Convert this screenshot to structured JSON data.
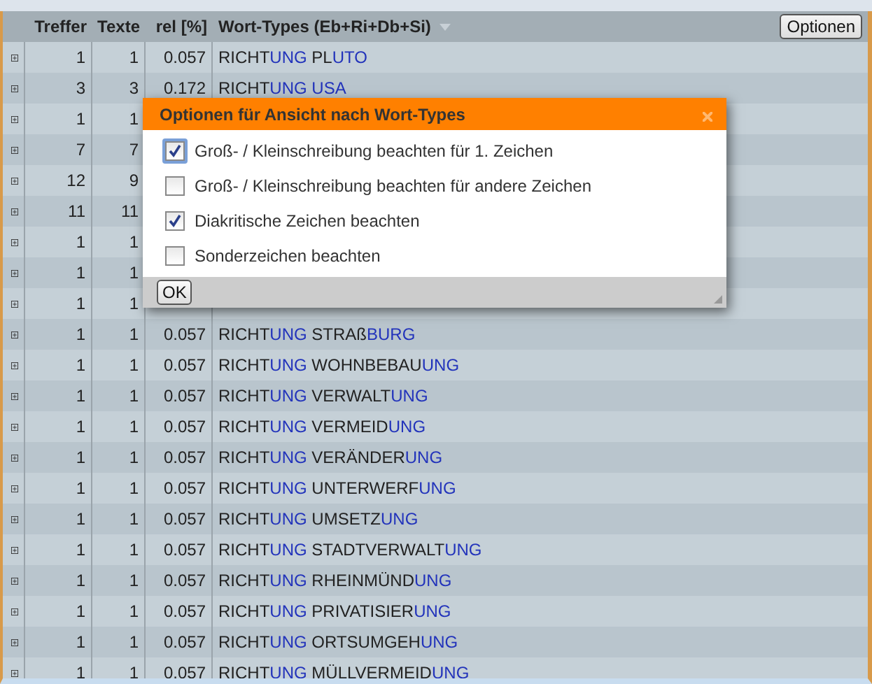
{
  "table": {
    "columns": [
      "Treffer",
      "Texte",
      "rel [%]",
      "Wort-Types (Eb+Ri+Db+Si)"
    ],
    "options_button": "Optionen",
    "rows": [
      {
        "treffer": "1",
        "texte": "1",
        "rel": "0.057",
        "parts": [
          "RICHT",
          "UNG",
          " PL",
          "UTO"
        ]
      },
      {
        "treffer": "3",
        "texte": "3",
        "rel": "0.172",
        "parts": [
          "RICHT",
          "UNG USA"
        ]
      },
      {
        "treffer": "1",
        "texte": "1"
      },
      {
        "treffer": "7",
        "texte": "7"
      },
      {
        "treffer": "12",
        "texte": "9"
      },
      {
        "treffer": "11",
        "texte": "11"
      },
      {
        "treffer": "1",
        "texte": "1"
      },
      {
        "treffer": "1",
        "texte": "1"
      },
      {
        "treffer": "1",
        "texte": "1"
      },
      {
        "treffer": "1",
        "texte": "1",
        "rel": "0.057",
        "parts": [
          "RICHT",
          "UNG",
          " STRAß",
          "BURG"
        ]
      },
      {
        "treffer": "1",
        "texte": "1",
        "rel": "0.057",
        "parts": [
          "RICHT",
          "UNG",
          " WOHNBEBAU",
          "UNG"
        ]
      },
      {
        "treffer": "1",
        "texte": "1",
        "rel": "0.057",
        "parts": [
          "RICHT",
          "UNG",
          " VERWALT",
          "UNG"
        ]
      },
      {
        "treffer": "1",
        "texte": "1",
        "rel": "0.057",
        "parts": [
          "RICHT",
          "UNG",
          " VERMEID",
          "UNG"
        ]
      },
      {
        "treffer": "1",
        "texte": "1",
        "rel": "0.057",
        "parts": [
          "RICHT",
          "UNG",
          " VERÄNDER",
          "UNG"
        ]
      },
      {
        "treffer": "1",
        "texte": "1",
        "rel": "0.057",
        "parts": [
          "RICHT",
          "UNG",
          " UNTERWERF",
          "UNG"
        ]
      },
      {
        "treffer": "1",
        "texte": "1",
        "rel": "0.057",
        "parts": [
          "RICHT",
          "UNG",
          " UMSETZ",
          "UNG"
        ]
      },
      {
        "treffer": "1",
        "texte": "1",
        "rel": "0.057",
        "parts": [
          "RICHT",
          "UNG",
          " STADTVERWALT",
          "UNG"
        ]
      },
      {
        "treffer": "1",
        "texte": "1",
        "rel": "0.057",
        "parts": [
          "RICHT",
          "UNG",
          " RHEINMÜND",
          "UNG"
        ]
      },
      {
        "treffer": "1",
        "texte": "1",
        "rel": "0.057",
        "parts": [
          "RICHT",
          "UNG",
          " PRIVATISIER",
          "UNG"
        ]
      },
      {
        "treffer": "1",
        "texte": "1",
        "rel": "0.057",
        "parts": [
          "RICHT",
          "UNG",
          " ORTSUMGEH",
          "UNG"
        ]
      },
      {
        "treffer": "1",
        "texte": "1",
        "rel": "0.057",
        "parts": [
          "RICHT",
          "UNG",
          " MÜLLVERMEID",
          "UNG"
        ]
      }
    ]
  },
  "dialog": {
    "title": "Optionen für Ansicht nach Wort-Types",
    "ok_button": "OK",
    "options": [
      {
        "label": "Groß- / Kleinschreibung beachten für 1. Zeichen",
        "checked": true,
        "focused": true
      },
      {
        "label": "Groß- / Kleinschreibung beachten für andere Zeichen",
        "checked": false,
        "focused": false
      },
      {
        "label": "Diakritische Zeichen beachten",
        "checked": true,
        "focused": false
      },
      {
        "label": "Sonderzeichen beachten",
        "checked": false,
        "focused": false
      }
    ]
  }
}
